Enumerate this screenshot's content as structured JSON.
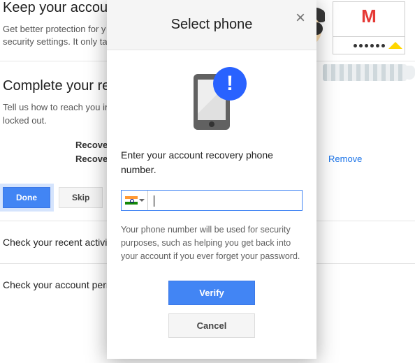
{
  "bg": {
    "secure": {
      "title": "Keep your account secure.",
      "sub1": "Get better protection for y",
      "sub2": "security settings. It only ta"
    },
    "recovery": {
      "title": "Complete your re",
      "sub1": "Tell us how to reach you in                                                                              you accidentally get",
      "sub2": "locked out.",
      "row1": "Recover",
      "row2": "Recove",
      "remove": "Remove"
    },
    "buttons": {
      "done": "Done",
      "skip": "Skip"
    },
    "activity": "Check your recent activi",
    "permissions": "Check your account permissions"
  },
  "modal": {
    "title": "Select phone",
    "prompt": "Enter your account recovery phone number.",
    "country": "IN",
    "phone_value": "",
    "helper": "Your phone number will be used for security purposes, such as helping you get back into your account if you ever forget your password.",
    "verify": "Verify",
    "cancel": "Cancel"
  }
}
